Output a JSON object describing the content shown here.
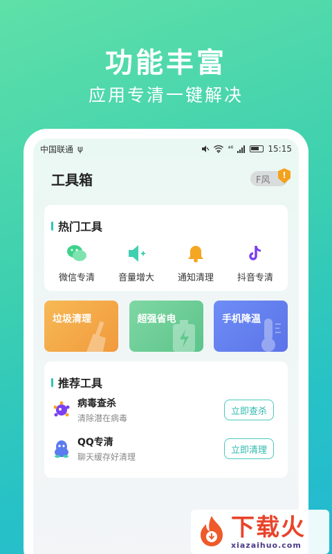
{
  "banner": {
    "title": "功能丰富",
    "subtitle": "应用专清一键解决"
  },
  "statusbar": {
    "carrier": "中国联通",
    "usb_icon": "ψ",
    "signal_text": "⁴⁶",
    "time": "15:15"
  },
  "header": {
    "title": "工具箱",
    "toggle_label": "F风",
    "toggle_warn": "!"
  },
  "hot_tools": {
    "title": "热门工具",
    "items": [
      {
        "label": "微信专清",
        "icon": "wechat-icon",
        "color": "#3ed38b"
      },
      {
        "label": "音量增大",
        "icon": "speaker-icon",
        "color": "#3fcfb1"
      },
      {
        "label": "通知清理",
        "icon": "bell-icon",
        "color": "#f5a623"
      },
      {
        "label": "抖音专清",
        "icon": "tiktok-icon",
        "color": "#7b3ff0"
      }
    ]
  },
  "tiles": [
    {
      "label": "垃圾清理",
      "icon": "broom-icon",
      "color": "#f2a444"
    },
    {
      "label": "超强省电",
      "icon": "battery-bolt-icon",
      "color": "#66c990"
    },
    {
      "label": "手机降温",
      "icon": "thermometer-icon",
      "color": "#627ef0"
    }
  ],
  "recommended": {
    "title": "推荐工具",
    "items": [
      {
        "name": "病毒查杀",
        "desc": "清除潜在病毒",
        "button": "立即查杀",
        "icon": "virus-icon"
      },
      {
        "name": "QQ专清",
        "desc": "聊天缓存好清理",
        "button": "立即清理",
        "icon": "qq-penguin-icon"
      }
    ]
  },
  "watermark": {
    "cn": "下载火",
    "url": "xiazaihuo.com"
  }
}
